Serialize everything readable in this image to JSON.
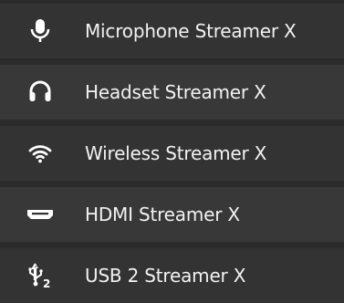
{
  "menu": {
    "items": [
      {
        "label": "Microphone Streamer X",
        "icon": "microphone-icon"
      },
      {
        "label": "Headset Streamer X",
        "icon": "headset-icon"
      },
      {
        "label": "Wireless Streamer X",
        "icon": "wifi-icon"
      },
      {
        "label": "HDMI Streamer X",
        "icon": "hdmi-icon"
      },
      {
        "label": "USB 2 Streamer X",
        "icon": "usb-icon"
      }
    ]
  },
  "colors": {
    "background": "#2b2b2b",
    "item": "#333333",
    "item_alt": "#383838",
    "text": "#f2f2f2",
    "icon": "#ffffff"
  }
}
